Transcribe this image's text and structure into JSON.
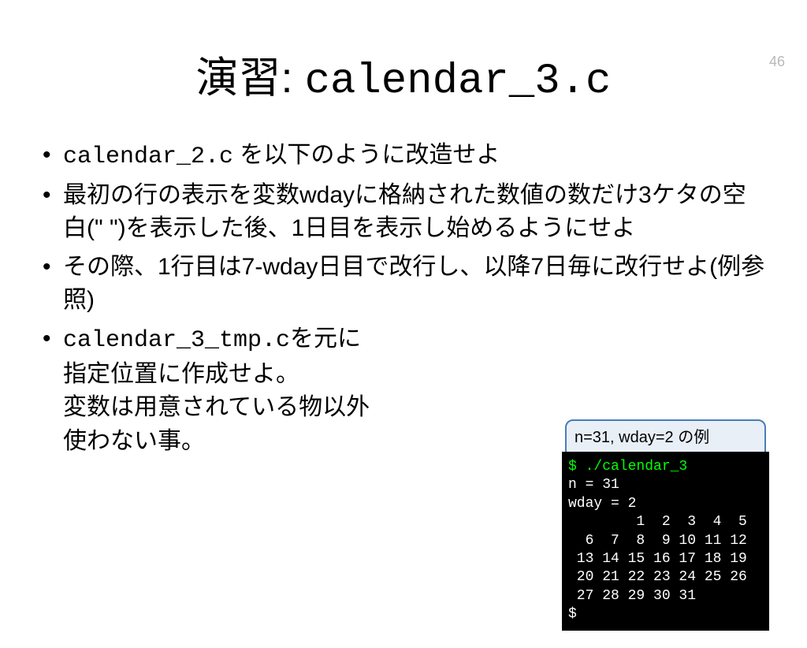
{
  "page_number": "46",
  "title_prefix": "演習: ",
  "title_code": "calendar_3.c",
  "bullets": {
    "b1_a": "calendar_2.c",
    "b1_b": " を以下のように改造せよ",
    "b2": "最初の行の表示を変数wdayに格納された数値の数だけ3ケタの空白(\"   \")を表示した後、1日目を表示し始めるようにせよ",
    "b3": "その際、1行目は7-wday日目で改行し、以降7日毎に改行せよ(例参照)",
    "b4_a": "calendar_3_tmp.c",
    "b4_b": "を元に\n指定位置に作成せよ。\n変数は用意されている物以外\n使わない事。"
  },
  "example": {
    "label": "n=31, wday=2 の例",
    "cmd": "$ ./calendar_3",
    "out": "n = 31\nwday = 2\n        1  2  3  4  5\n  6  7  8  9 10 11 12\n 13 14 15 16 17 18 19\n 20 21 22 23 24 25 26\n 27 28 29 30 31\n$"
  }
}
